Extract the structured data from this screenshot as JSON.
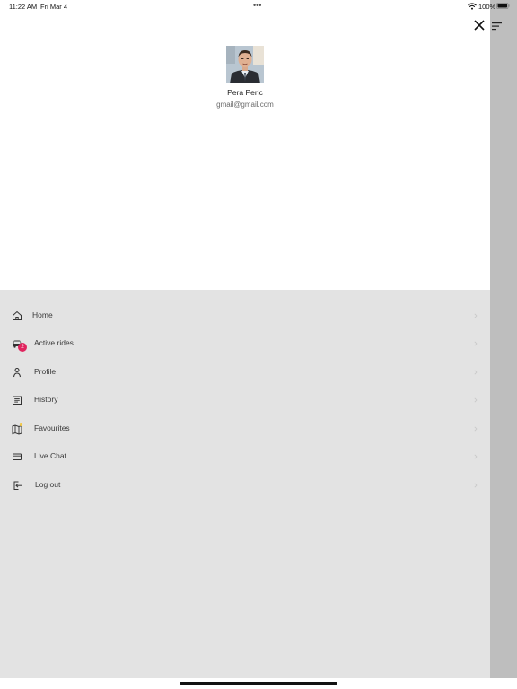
{
  "status_bar": {
    "time": "11:22 AM",
    "date": "Fri Mar 4",
    "dots": "•••",
    "battery_pct": "100%"
  },
  "user": {
    "name": "Pera Peric",
    "email": "gmail@gmail.com"
  },
  "menu": {
    "items": [
      {
        "label": "Home",
        "icon": "home-icon"
      },
      {
        "label": "Active rides",
        "icon": "car-icon",
        "badge": "2"
      },
      {
        "label": "Profile",
        "icon": "person-icon"
      },
      {
        "label": "History",
        "icon": "list-icon"
      },
      {
        "label": "Favourites",
        "icon": "map-star-icon"
      },
      {
        "label": "Live Chat",
        "icon": "chat-icon"
      },
      {
        "label": "Log out",
        "icon": "logout-icon"
      }
    ]
  },
  "colors": {
    "menu_background": "#e3e3e3",
    "side_strip": "#bebebe",
    "badge": "#e0245e"
  }
}
